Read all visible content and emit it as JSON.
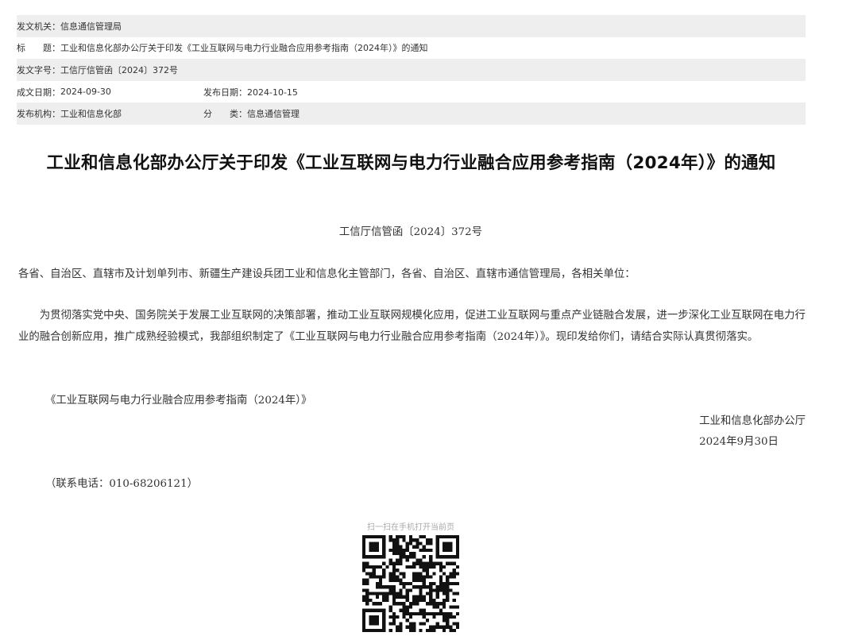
{
  "meta": {
    "issuer_label": "发文机关：",
    "issuer": "信息通信管理局",
    "title_label": "标　　题：",
    "title": "工业和信息化部办公厅关于印发《工业互联网与电力行业融合应用参考指南（2024年）》的通知",
    "docno_label": "发文字号：",
    "docno": "工信厅信管函〔2024〕372号",
    "created_label": "成文日期：",
    "created": "2024-09-30",
    "published_label": "发布日期：",
    "published": "2024-10-15",
    "org_label": "发布机构：",
    "org": "工业和信息化部",
    "category_label": "分　　类：",
    "category": "信息通信管理"
  },
  "article": {
    "title": "工业和信息化部办公厅关于印发《工业互联网与电力行业融合应用参考指南（2024年）》的通知",
    "doc_number": "工信厅信管函〔2024〕372号",
    "salutation": "各省、自治区、直辖市及计划单列市、新疆生产建设兵团工业和信息化主管部门，各省、自治区、直辖市通信管理局，各相关单位：",
    "body": "为贯彻落实党中央、国务院关于发展工业互联网的决策部署，推动工业互联网规模化应用，促进工业互联网与重点产业链融合发展，进一步深化工业互联网在电力行业的融合创新应用，推广成熟经验模式，我部组织制定了《工业互联网与电力行业融合应用参考指南（2024年）》。现印发给你们，请结合实际认真贯彻落实。",
    "attachment": "《工业互联网与电力行业融合应用参考指南（2024年）》",
    "signer": "工业和信息化部办公厅",
    "sign_date": "2024年9月30日",
    "contact": "（联系电话：010-68206121）"
  },
  "qr": {
    "label": "扫一扫在手机打开当前页"
  }
}
